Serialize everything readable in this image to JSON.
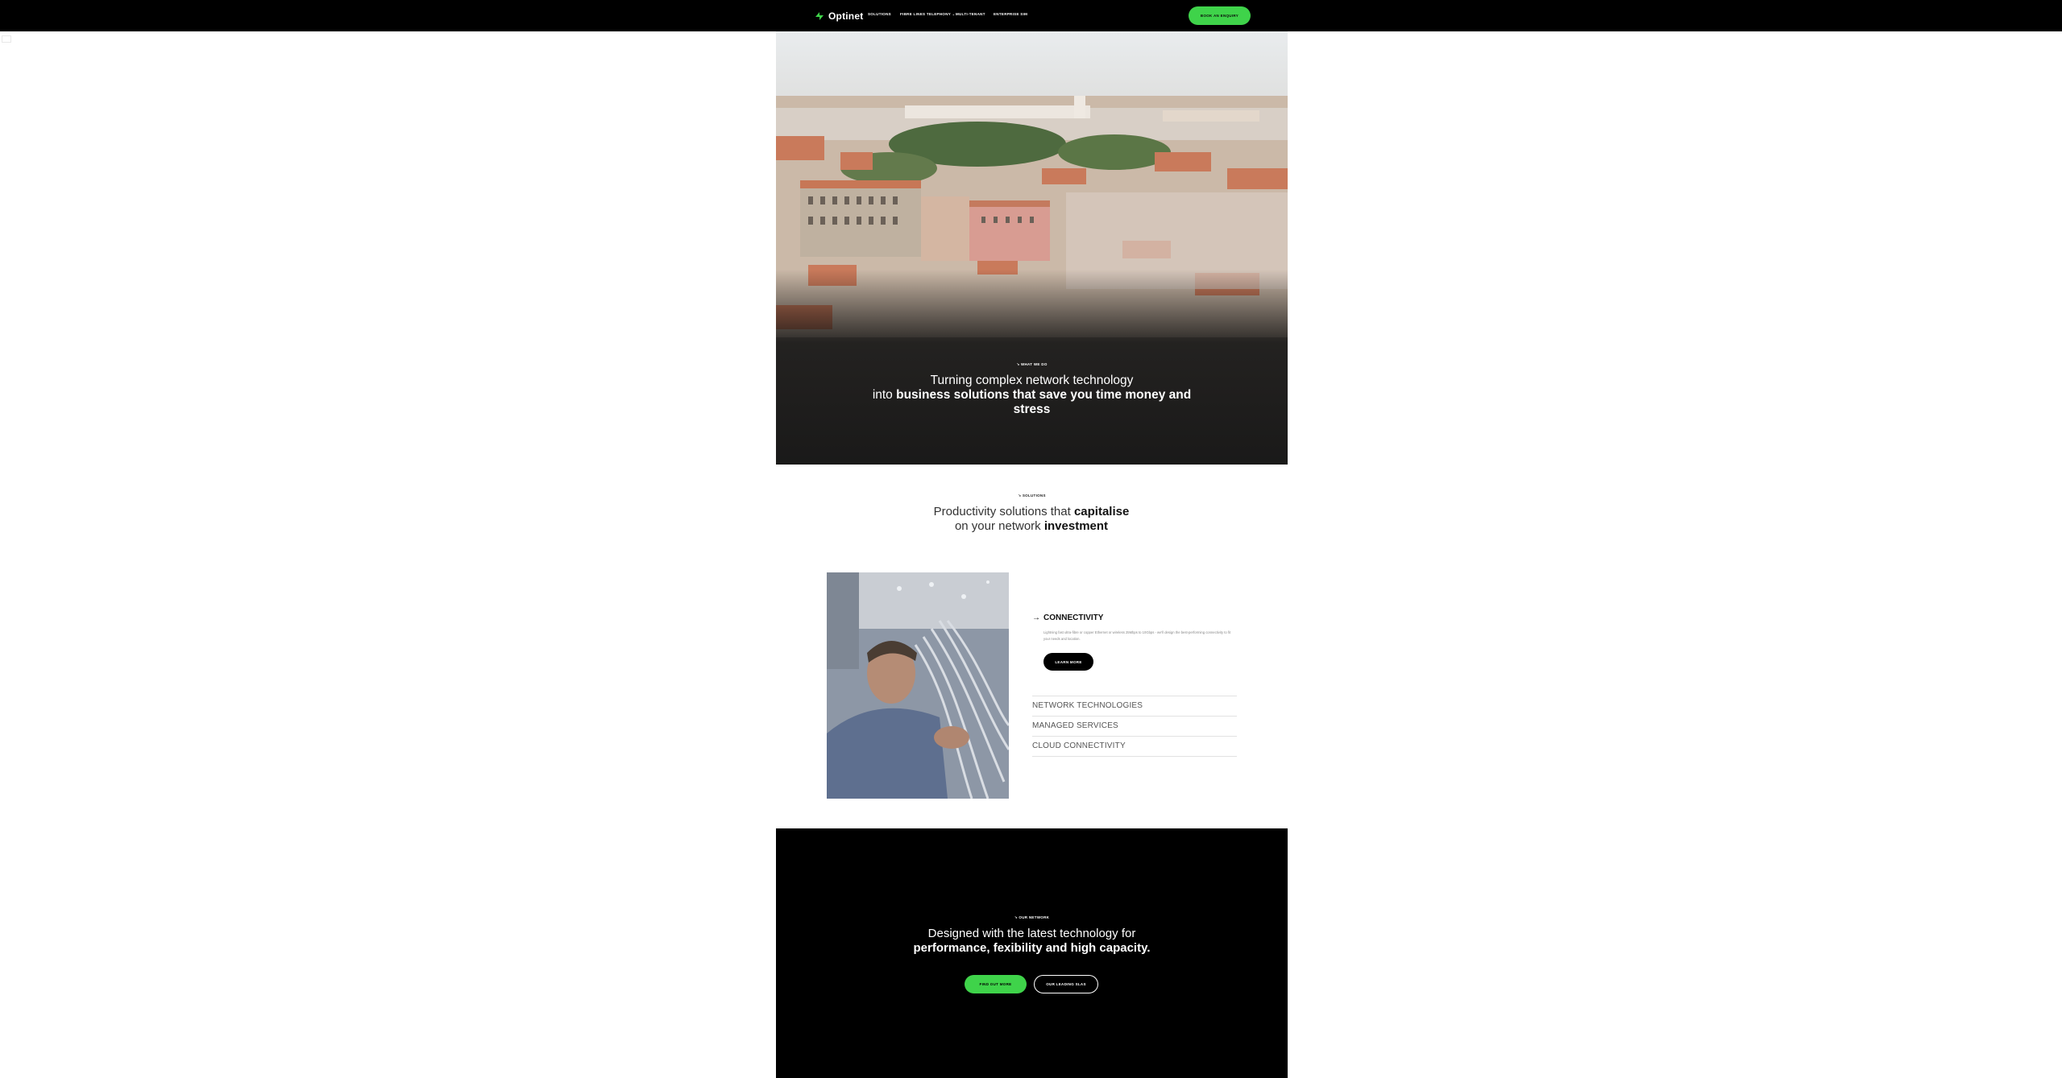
{
  "nav": {
    "brand": "Optinet",
    "links": [
      "SOLUTIONS",
      "FIBRE LINES TELEPHONY ⌄",
      "MULTI-TENANT",
      "ENTERPRISE SIM"
    ],
    "cta": "BOOK AN ENQUIRY"
  },
  "hero": {
    "eyebrow": "↘ WHAT WE DO",
    "title_plain_1": "Turning complex network technology",
    "title_plain_2": "into ",
    "title_bold": "business solutions that save you time money and stress"
  },
  "solutions": {
    "eyebrow": "↘ SOLUTIONS",
    "title_plain_1": "Productivity solutions that ",
    "title_bold_1": "capitalise",
    "title_plain_2": "on your network ",
    "title_bold_2": "investment",
    "active": {
      "arrow": "→",
      "heading": "CONNECTIVITY",
      "description": "Lightning fast ultra-fibre or copper Ethernet or wireless 25Mbps to 10Gbps - we'll design the best-performing connectivity to fit your needs and location.",
      "button": "LEARN MORE"
    },
    "items": [
      "NETWORK TECHNOLOGIES",
      "MANAGED SERVICES",
      "CLOUD CONNECTIVITY"
    ]
  },
  "network": {
    "eyebrow": "↘ OUR NETWORK",
    "title_plain": "Designed with the latest technology for",
    "title_bold": "performance, fexibility and high capacity.",
    "primary_button": "FIND OUT MORE",
    "secondary_button": "OUR LEADING SLAS"
  },
  "colors": {
    "accent_green": "#3fd34a",
    "nav_bg": "#000000",
    "network_bg": "#000000"
  },
  "icons": {
    "logo": "optinet-logo-icon",
    "arrow": "arrow-right-icon"
  }
}
